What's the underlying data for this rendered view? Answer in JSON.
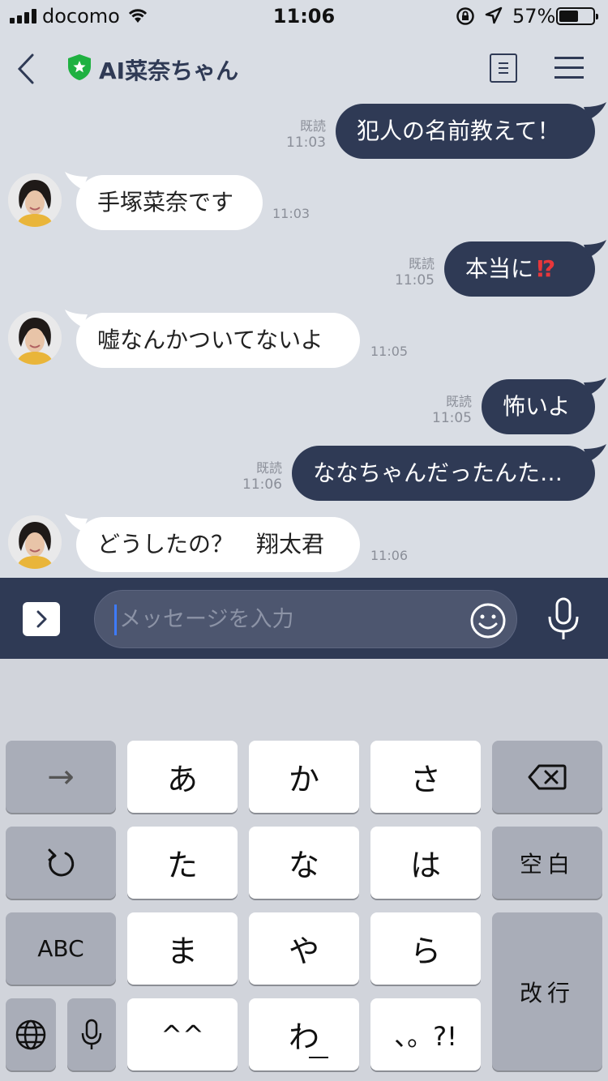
{
  "status_bar": {
    "carrier": "docomo",
    "time": "11:06",
    "battery": "57%",
    "battery_level": 0.57
  },
  "header": {
    "title": "AI菜奈ちゃん"
  },
  "messages": [
    {
      "side": "out",
      "text": "犯人の名前教えて！",
      "read": "既読",
      "time": "11:03"
    },
    {
      "side": "in",
      "text": "手塚菜奈です",
      "time": "11:03"
    },
    {
      "side": "out",
      "text": "本当に",
      "emoji": "⁉",
      "read": "既読",
      "time": "11:05"
    },
    {
      "side": "in",
      "text": "嘘なんかついてないよ",
      "time": "11:05"
    },
    {
      "side": "out",
      "text": "怖いよ",
      "read": "既読",
      "time": "11:05"
    },
    {
      "side": "out",
      "text": "ななちゃんだったんた…",
      "read": "既読",
      "time": "11:06"
    },
    {
      "side": "in",
      "text": "どうしたの？　翔太君",
      "time": "11:06"
    }
  ],
  "input": {
    "placeholder": "メッセージを入力"
  },
  "keyboard": {
    "arrow": "→",
    "keys": [
      "あ",
      "か",
      "さ",
      "た",
      "な",
      "は",
      "ま",
      "や",
      "ら",
      "^^",
      "わ",
      "、。?!"
    ],
    "space": "空白",
    "abc": "ABC",
    "return": "改行"
  },
  "colors": {
    "bubble_out": "#2f3a55",
    "bubble_in": "#ffffff",
    "background": "#d9dde4",
    "accent_green": "#1fb141"
  }
}
